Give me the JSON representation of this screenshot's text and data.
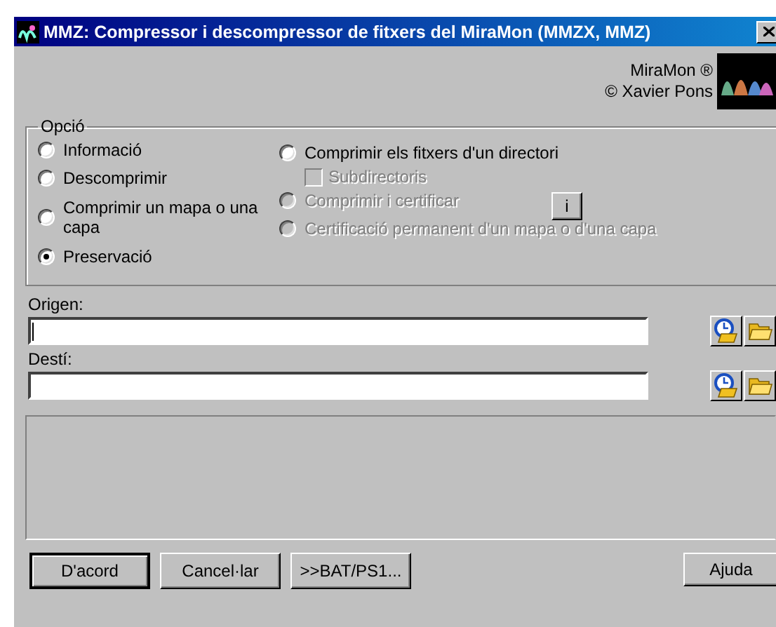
{
  "window": {
    "title": "MMZ: Compressor i descompressor de fitxers del MiraMon (MMZX, MMZ)"
  },
  "credits": [
    "MiraMon ®",
    "© Xavier Pons"
  ],
  "option_group": {
    "label": "Opció",
    "left": [
      {
        "kind": "radio",
        "label": "Informació",
        "selected": false,
        "disabled": false
      },
      {
        "kind": "radio",
        "label": "Descomprimir",
        "selected": false,
        "disabled": false
      },
      {
        "kind": "radio",
        "label": "Comprimir un mapa o una capa",
        "selected": false,
        "disabled": false
      },
      {
        "kind": "radio",
        "label": "Preservació",
        "selected": true,
        "disabled": false
      }
    ],
    "right": [
      {
        "kind": "radio",
        "label": "Comprimir els fitxers d'un directori",
        "selected": false,
        "disabled": false
      },
      {
        "kind": "checkbox",
        "label": "Subdirectoris",
        "checked": false,
        "disabled": true
      },
      {
        "kind": "radio",
        "label": "Comprimir i certificar",
        "selected": false,
        "disabled": true
      },
      {
        "kind": "radio",
        "label": "Certificació permanent d'un mapa o d'una capa",
        "selected": false,
        "disabled": true
      }
    ],
    "info_button": "i"
  },
  "fields": [
    {
      "label": "Origen:",
      "focused": true
    },
    {
      "label": "Destí:",
      "focused": false
    }
  ],
  "buttons": [
    {
      "label": "D'acord",
      "default": true
    },
    {
      "label": "Cancel·lar",
      "default": false
    },
    {
      "label": ">>BAT/PS1...",
      "default": false
    }
  ],
  "help_button": "Ajuda"
}
